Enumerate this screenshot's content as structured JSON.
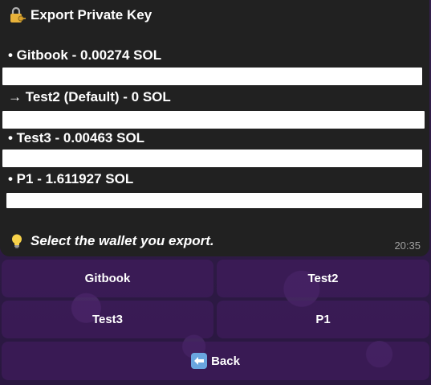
{
  "message": {
    "title": "Export Private Key",
    "title_icon": "lock-with-key-icon",
    "wallets": [
      {
        "text": "• Gitbook - 0.00274 SOL"
      },
      {
        "text": "→ Test2 (Default) - 0 SOL"
      },
      {
        "text": "• Test3 - 0.00463 SOL"
      },
      {
        "text": "• P1 - 1.611927 SOL"
      }
    ],
    "hint": "Select the wallet you export.",
    "hint_icon": "light-bulb-icon",
    "time": "20:35"
  },
  "keyboard": {
    "buttons": [
      {
        "label": "Gitbook"
      },
      {
        "label": "Test2"
      },
      {
        "label": "Test3"
      },
      {
        "label": "P1"
      }
    ],
    "back": {
      "label": "Back",
      "icon": "left-arrow-icon"
    }
  },
  "colors": {
    "message_bg": "#212121",
    "chat_bg": "#2a1740",
    "button_bg": "#46206a",
    "text": "#ffffff",
    "timestamp": "#a0a0a0"
  }
}
